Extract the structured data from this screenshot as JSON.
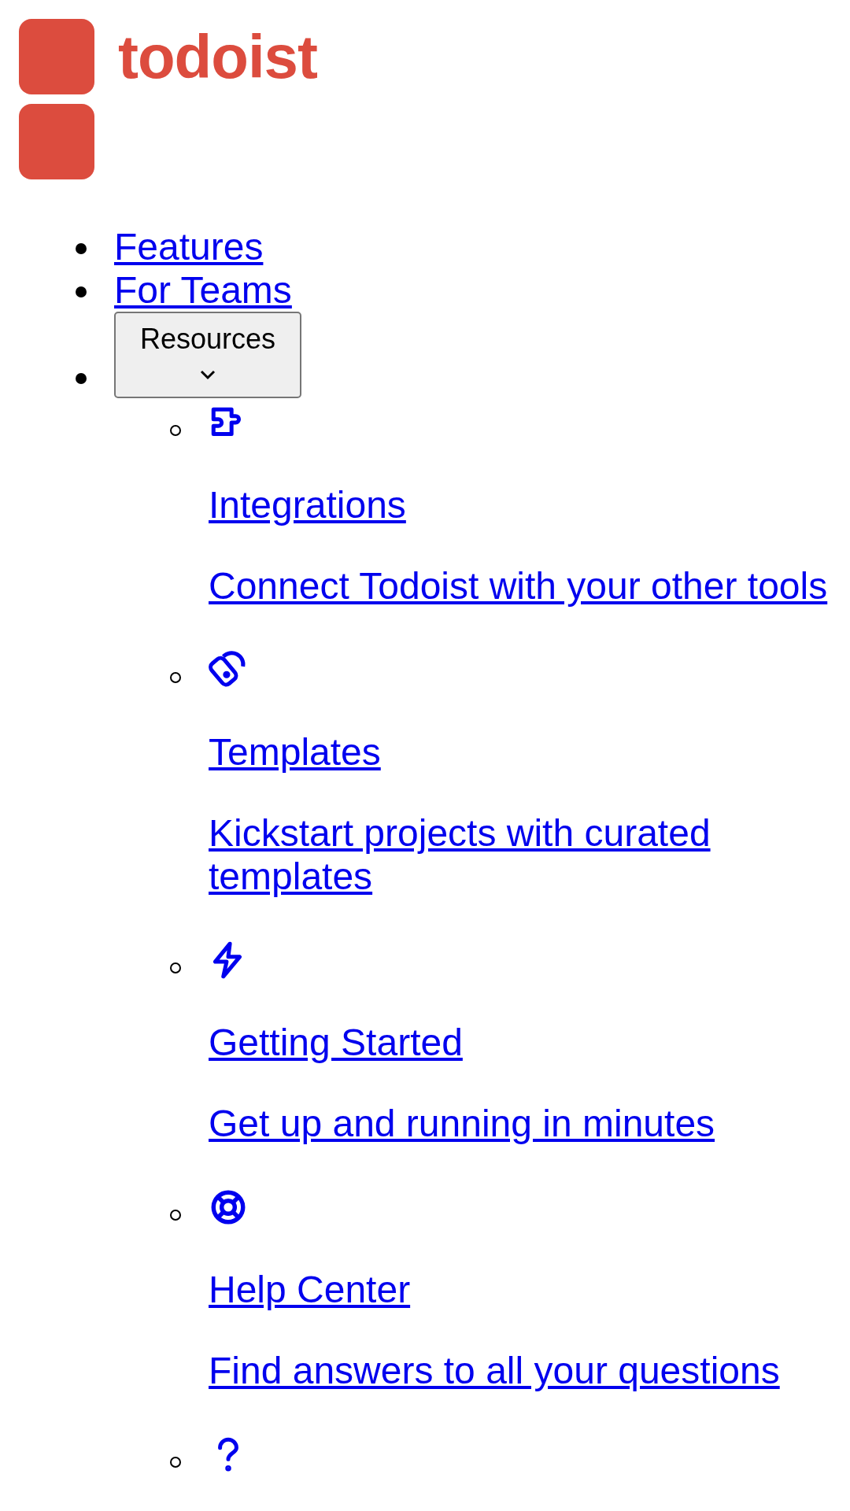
{
  "logo": {
    "wordmark": "todoist"
  },
  "nav": [
    {
      "kind": "link",
      "label": "Features"
    },
    {
      "kind": "link",
      "label": "For Teams"
    },
    {
      "kind": "menu",
      "label": "Resources",
      "expanded": true,
      "items": [
        {
          "kind": "link",
          "title": "Integrations",
          "description": "Connect Todoist with your other tools"
        },
        {
          "kind": "link",
          "title": "Templates",
          "description": "Kickstart projects with curated templates"
        },
        {
          "kind": "link",
          "title": "Getting Started",
          "description": "Get up and running in minutes"
        },
        {
          "kind": "link",
          "title": "Help Center",
          "description": "Find answers to all your questions"
        },
        {
          "kind": "icon"
        }
      ]
    }
  ]
}
